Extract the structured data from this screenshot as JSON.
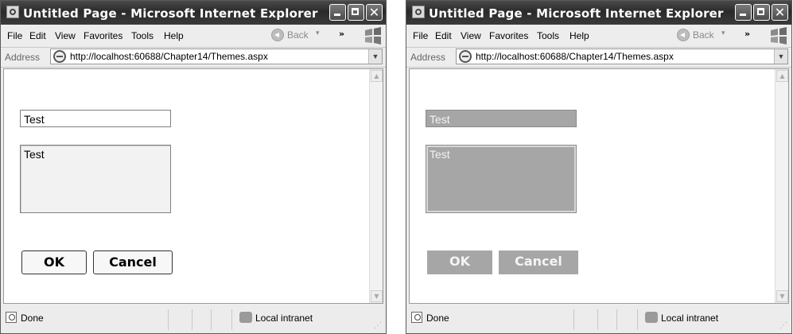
{
  "windows": [
    {
      "title": "Untitled Page - Microsoft Internet Explorer",
      "menu": [
        "File",
        "Edit",
        "View",
        "Favorites",
        "Tools",
        "Help"
      ],
      "back_label": "Back",
      "address_label": "Address",
      "url": "http://localhost:60688/Chapter14/Themes.aspx",
      "textbox_value": "Test",
      "textarea_value": "Test",
      "ok_label": "OK",
      "cancel_label": "Cancel",
      "status_text": "Done",
      "zone_text": "Local intranet",
      "theme": "default"
    },
    {
      "title": "Untitled Page - Microsoft Internet Explorer",
      "menu": [
        "File",
        "Edit",
        "View",
        "Favorites",
        "Tools",
        "Help"
      ],
      "back_label": "Back",
      "address_label": "Address",
      "url": "http://localhost:60688/Chapter14/Themes.aspx",
      "textbox_value": "Test",
      "textarea_value": "Test",
      "ok_label": "OK",
      "cancel_label": "Cancel",
      "status_text": "Done",
      "zone_text": "Local intranet",
      "theme": "gray"
    }
  ],
  "colors": {
    "titlebar": "#3a3a3a",
    "themed_control": "#a6a6a6",
    "themed_text": "#f4f4f4"
  },
  "icons": [
    "ie-page-icon",
    "minimize-icon",
    "maximize-icon",
    "close-icon",
    "back-arrow-icon",
    "windows-logo-icon",
    "status-page-icon",
    "intranet-zone-icon"
  ]
}
